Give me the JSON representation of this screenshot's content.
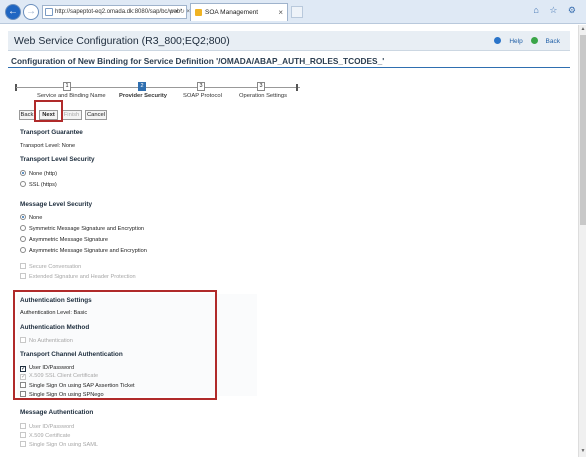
{
  "browser": {
    "address": "http://sapeptot-eq2.omada.dk:8080/sap/bc/web",
    "address_host_bold": "omada.dk",
    "address_controls": "ρ ▾ ↻ ×",
    "tab_title": "SOA Management",
    "tab_close": "×",
    "right_icons": "⌂ ☆ ⚙"
  },
  "page": {
    "title": "Web Service Configuration (R3_800;EQ2;800)",
    "help_label": "Help",
    "back_label": "Back",
    "subtitle": "Configuration of New Binding for Service Definition '/OMADA/ABAP_AUTH_ROLES_TCODES_'"
  },
  "roadmap": {
    "steps": [
      {
        "number": "1",
        "label": "Service and Binding Name"
      },
      {
        "number": "2",
        "label": "Provider Security"
      },
      {
        "number": "3",
        "label": "SOAP Protocol"
      },
      {
        "number": "3",
        "label": "Operation Settings"
      }
    ],
    "active_index": 1
  },
  "buttons": {
    "back": "Back",
    "next": "Next",
    "finish": "Finish",
    "cancel": "Cancel"
  },
  "transport_guarantee": {
    "heading": "Transport Guarantee",
    "level_label": "Transport Level:",
    "level_value": "None"
  },
  "transport_level_security": {
    "heading": "Transport Level Security",
    "options": [
      "None (http)",
      "SSL (https)"
    ],
    "selected": 0
  },
  "message_level_security": {
    "heading": "Message Level Security",
    "options": [
      "None",
      "Symmetric Message Signature and Encryption",
      "Asymmetric Message Signature",
      "Asymmetric Message Signature and Encryption"
    ],
    "selected": 0,
    "disabled_checkboxes": [
      "Secure Conversation",
      "Extended Signature and Header Protection"
    ]
  },
  "authentication_settings": {
    "heading": "Authentication Settings",
    "level_label": "Authentication Level:",
    "level_value": "Basic"
  },
  "authentication_method": {
    "heading": "Authentication Method",
    "no_auth": "No Authentication"
  },
  "transport_channel_auth": {
    "heading": "Transport Channel Authentication",
    "items": [
      {
        "label": "User ID/Password",
        "checked": true,
        "enabled": true
      },
      {
        "label": "X.509 SSL Client Certificate",
        "checked": true,
        "enabled": false
      },
      {
        "label": "Single Sign On using SAP Assertion Ticket",
        "checked": false,
        "enabled": true
      },
      {
        "label": "Single Sign On using SPNego",
        "checked": false,
        "enabled": true
      }
    ]
  },
  "message_authentication": {
    "heading": "Message Authentication",
    "items": [
      "User ID/Password",
      "X.509 Certificate",
      "Single Sign On using SAML"
    ]
  }
}
